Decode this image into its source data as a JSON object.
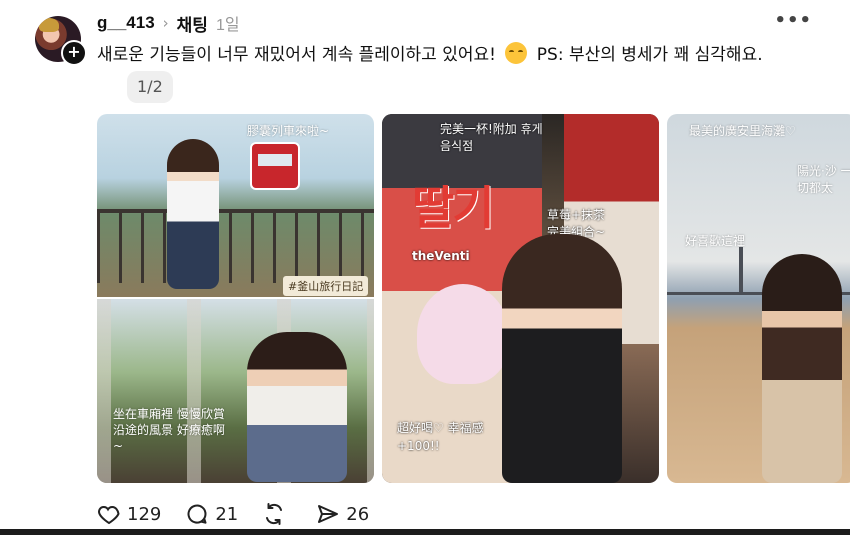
{
  "post": {
    "username": "g__413",
    "topic": "채팅",
    "time": "1일",
    "text": "새로운 기능들이 너무 재밌어서 계속 플레이하고 있어요!",
    "text_after_emoji": "PS: 부산의 병세가 꽤 심각해요.",
    "page_indicator": "1/2"
  },
  "images": {
    "photo1": {
      "tag_top": "膠囊列車來啦~",
      "tag_mid": "#釜山旅行日記",
      "note_bottom": "坐在車廂裡 慢慢欣賞沿途的風景 好療癒啊~"
    },
    "photo2": {
      "brand_top": "完美一杯!附加 휴게음식점",
      "sign_big": "딸기",
      "brand_logo": "theVenti",
      "sticker": "草莓+抹茶 完美組合~",
      "note_bottom": "超好喝♡ 幸福感+100!!"
    },
    "photo3": {
      "title": "最美的廣安里海灘♡",
      "side_note": "陽光·沙 一切都太",
      "note_mid": "好喜歡這裡"
    }
  },
  "actions": {
    "likes": "129",
    "comments": "21",
    "reposts": "",
    "shares": "26"
  },
  "icons": {
    "like": "heart-icon",
    "comment": "comment-icon",
    "repost": "repost-icon",
    "share": "send-icon",
    "more": "more-icon",
    "follow": "plus-icon",
    "chevron": "chevron-right-icon"
  }
}
